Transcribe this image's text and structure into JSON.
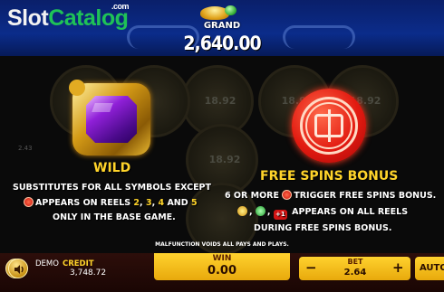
{
  "logo": {
    "slot": "Slot",
    "catalog": "Catalog",
    "com": ".com"
  },
  "jackpot": {
    "label": "GRAND",
    "value": "2,640.00"
  },
  "wild": {
    "title": "WILD",
    "line1": "SUBSTITUTES FOR ALL SYMBOLS EXCEPT",
    "line2_pre": "APPEARS ON REELS",
    "reels": [
      "2",
      "3",
      "4"
    ],
    "and": "AND",
    "last_reel": "5",
    "line3": "ONLY IN THE BASE GAME."
  },
  "free_spins": {
    "title": "FREE SPINS BONUS",
    "line1_count": "6 OR MORE",
    "line1_rest": "TRIGGER FREE SPINS BONUS.",
    "line2_plus": "+1",
    "line2_rest": "APPEARS ON ALL REELS",
    "line3": "DURING FREE SPINS BONUS."
  },
  "background_values": [
    "18.92",
    "18.92",
    "18.92",
    "18.92",
    "2.43"
  ],
  "notice": "MALFUNCTION VOIDS ALL PAYS AND PLAYS.",
  "bottom": {
    "demo": "DEMO",
    "credit_label": "CREDIT",
    "credit_value": "3,748.72",
    "win_label": "WIN",
    "win_value": "0.00",
    "bet_label": "BET",
    "bet_value": "2.64",
    "minus": "−",
    "plus": "+",
    "auto": "AUTO"
  },
  "colors": {
    "gold": "#ffd42a",
    "brand_green": "#1fc257",
    "bar_bg": "#1a0604"
  }
}
